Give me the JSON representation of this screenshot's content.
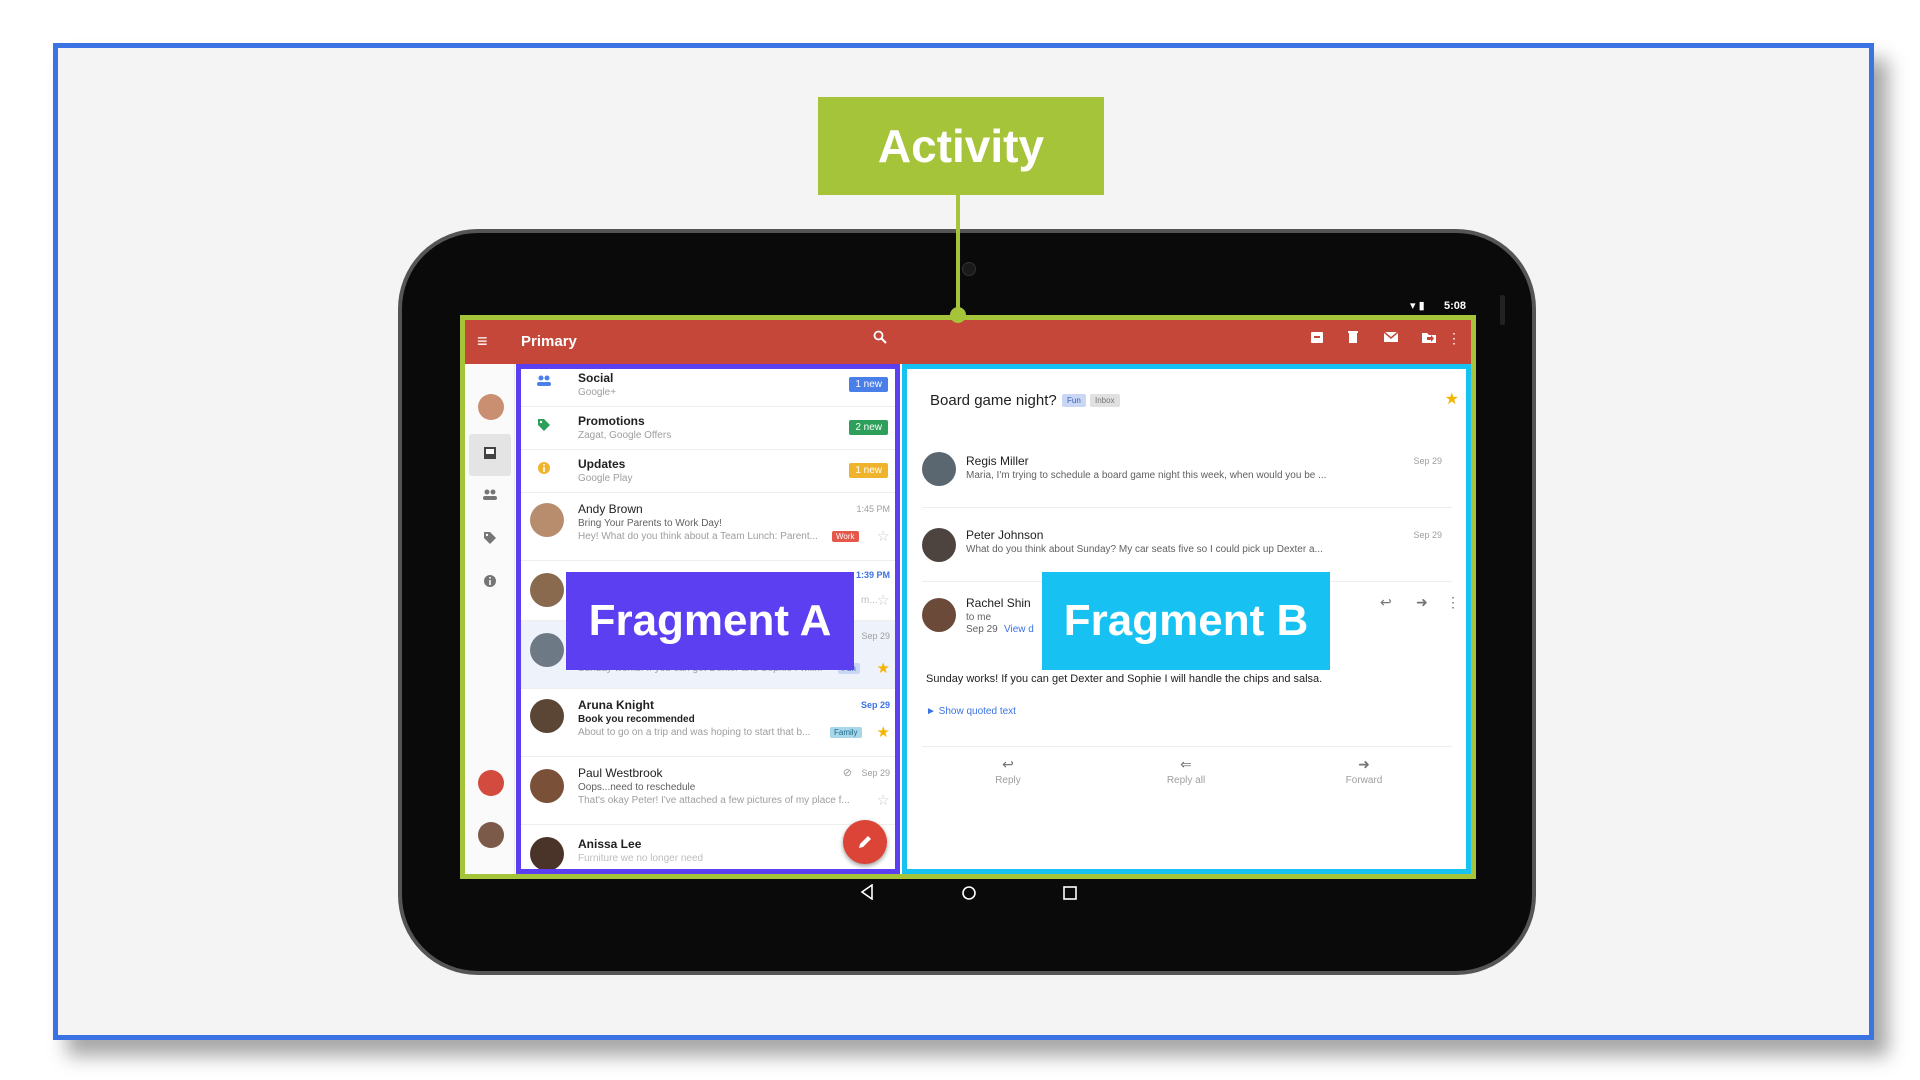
{
  "labels": {
    "activity": "Activity",
    "fragment_a": "Fragment A",
    "fragment_b": "Fragment B"
  },
  "colors": {
    "frame_border": "#3b73e5",
    "activity": "#a6c43a",
    "fragment_a": "#5b3ff0",
    "fragment_b": "#17c2f2",
    "toolbar": "#c5473a"
  },
  "status_bar": {
    "time": "5:08"
  },
  "toolbar": {
    "title": "Primary",
    "icons": [
      "menu-icon",
      "search-icon",
      "archive-icon",
      "delete-icon",
      "mail-icon",
      "move-to-folder-icon",
      "more-vert-icon"
    ]
  },
  "nav_rail": {
    "icons": [
      "avatar",
      "inbox-icon",
      "people-icon",
      "tag-icon",
      "info-icon",
      "avatar",
      "avatar"
    ]
  },
  "categories": [
    {
      "title": "Social",
      "sub": "Google+",
      "badge": "1 new",
      "badge_color": "#4a7ee8",
      "icon": "people-icon"
    },
    {
      "title": "Promotions",
      "sub": "Zagat, Google Offers",
      "badge": "2 new",
      "badge_color": "#2e9e5b",
      "icon": "tag-icon"
    },
    {
      "title": "Updates",
      "sub": "Google Play",
      "badge": "1 new",
      "badge_color": "#f0b32c",
      "icon": "info-icon"
    }
  ],
  "emails": [
    {
      "sender": "Andy Brown",
      "subject": "Bring Your Parents to Work Day!",
      "preview": "Hey! What do you think about a Team Lunch: Parent...",
      "date": "1:45 PM",
      "label": "Work"
    },
    {
      "sender": "",
      "subject": "",
      "preview": "m...",
      "date": "1:39 PM"
    },
    {
      "sender": "",
      "subject": "",
      "preview": "Sunday works! If you can get Dexter and Sophie I will...",
      "date": "Sep 29",
      "label": "Fun"
    },
    {
      "sender": "Aruna Knight",
      "subject": "Book you recommended",
      "preview": "About to go on a trip and was hoping to start that b...",
      "date": "Sep 29",
      "label": "Family"
    },
    {
      "sender": "Paul Westbrook",
      "subject": "Oops...need to reschedule",
      "preview": "That's okay Peter! I've attached a few pictures of my place f...",
      "date": "Sep 29"
    },
    {
      "sender": "Anissa Lee",
      "subject": "Furniture we no longer need",
      "preview": ""
    }
  ],
  "detail": {
    "subject": "Board game night?",
    "chips": [
      "Fun",
      "Inbox"
    ],
    "threads": [
      {
        "sender": "Regis Miller",
        "snippet": "Maria, I'm trying to schedule a board game night this week, when would you be ...",
        "date": "Sep 29"
      },
      {
        "sender": "Peter Johnson",
        "snippet": "What do you think about Sunday? My car seats five so I could pick up Dexter a...",
        "date": "Sep 29"
      }
    ],
    "open_message": {
      "sender": "Rachel Shin",
      "to": "to me",
      "date": "Sep 29",
      "view_link": "View d",
      "body": "Sunday works! If you can get Dexter and Sophie I will handle the chips and salsa.",
      "show_quoted": "► Show quoted text"
    },
    "actions": [
      "Reply",
      "Reply all",
      "Forward"
    ]
  }
}
